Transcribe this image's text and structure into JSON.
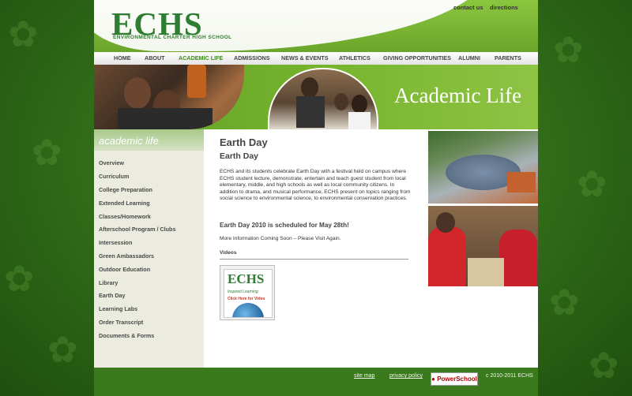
{
  "header": {
    "logo": "ECHS",
    "logo_subtitle": "ENVIRONMENTAL CHARTER HIGH SCHOOL",
    "top_links": [
      "contact us",
      "directions"
    ]
  },
  "nav": {
    "items": [
      "HOME",
      "ABOUT",
      "ACADEMIC LIFE",
      "ADMISSIONS",
      "NEWS & EVENTS",
      "ATHLETICS",
      "GIVING OPPORTUNITIES",
      "ALUMNI",
      "PARENTS"
    ],
    "active": "ACADEMIC LIFE"
  },
  "banner": {
    "title": "Academic Life"
  },
  "sidebar": {
    "heading": "academic life",
    "items": [
      "Overview",
      "Curriculum",
      "College Preparation",
      "Extended Learning",
      "Classes/Homework",
      "Afterschool Program / Clubs",
      "Intersession",
      "Green Ambassadors",
      "Outdoor Education",
      "Library",
      "Earth Day",
      "Learning Labs",
      "Order Transcript",
      "Documents & Forms"
    ]
  },
  "content": {
    "title": "Earth Day",
    "subtitle": "Earth Day",
    "body": "ECHS and its students celebrate Earth Day with a festival held on campus where ECHS student lecture, demonstrate, entertain and teach guest student from local elementary, middle, and high schools as well as local community citizens.    In addition to drama, and musical performance, ECHS present on topics ranging from social science to environmental science, to environmental conservation practices.",
    "schedule": "Earth Day 2010 is scheduled for May 28th!",
    "more_info": "More Information Coming Soon – Please Visit Again.",
    "videos_label": "Videos",
    "video_thumb": {
      "logo": "ECHS",
      "tagline": "Inspired Learning",
      "play_text": "Click Here for Video"
    }
  },
  "footer": {
    "links": [
      "site map",
      "privacy policy"
    ],
    "powerschool": "PowerSchool",
    "copyright": "c 2010-2011 ECHS"
  },
  "colors": {
    "brand_green": "#2e7d32",
    "header_green": "#8cc63f",
    "page_bg": "#2f6a18"
  }
}
